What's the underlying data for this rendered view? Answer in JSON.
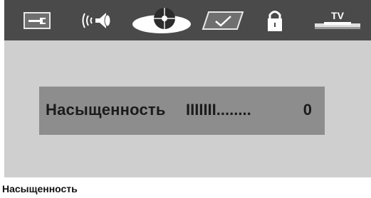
{
  "toolbar": {
    "items": [
      {
        "icon": "wrench-icon",
        "name": "settings"
      },
      {
        "icon": "speaker-icon",
        "name": "audio"
      },
      {
        "icon": "disc-icon",
        "name": "disc"
      },
      {
        "icon": "checkmark-icon",
        "name": "preferences"
      },
      {
        "icon": "lock-icon",
        "name": "parental-lock"
      },
      {
        "icon": "tv-icon",
        "name": "tv-setup",
        "label": "TV"
      }
    ]
  },
  "osd": {
    "label": "Насыщенность",
    "level": "IIIIIII........",
    "value": "0"
  },
  "caption": "Насыщенность",
  "colors": {
    "toolbar": "#4a4a4a",
    "panel": "#cfcfcf",
    "osd_box": "#8d8d8d"
  }
}
